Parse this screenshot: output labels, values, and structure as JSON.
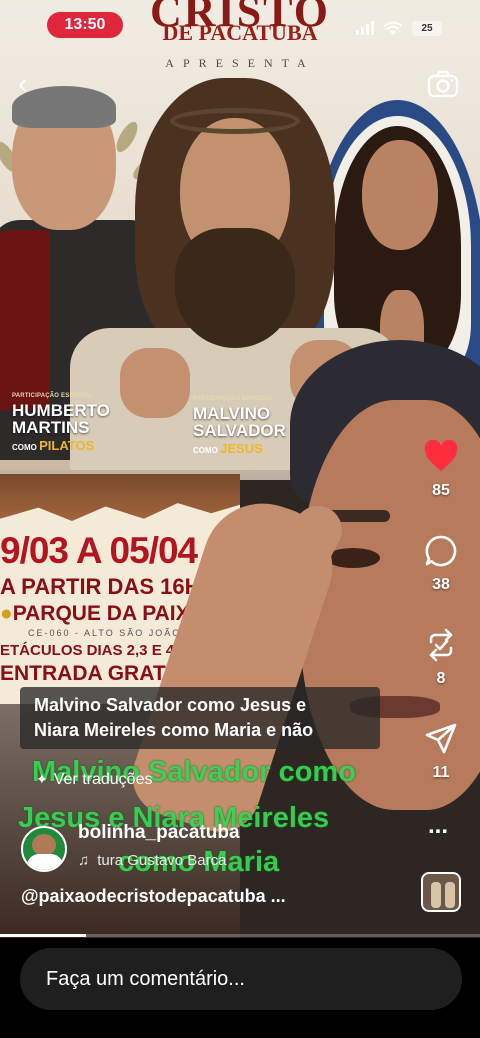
{
  "status_bar": {
    "time": "13:50",
    "battery": "25"
  },
  "poster": {
    "title_partial": "CRISTO",
    "subtitle": "DE PACATUBA",
    "presents": "APRESENTA",
    "credits": [
      {
        "small": "PARTICIPAÇÃO ESPECIAL",
        "line1": "HUMBERTO",
        "line2": "MARTINS",
        "como": "COMO",
        "role": "PILATOS"
      },
      {
        "small": "PARTICIPAÇÃO ESPECIAL",
        "line1": "MALVINO",
        "line2": "SALVADOR",
        "como": "COMO",
        "role": "JESUS"
      }
    ]
  },
  "event_poster": {
    "dates": "9/03 A 05/04",
    "time": "A PARTIR DAS 16H",
    "place": "PARQUE DA PAIXÃO",
    "location": "CE-060 - ALTO SÃO JOÃO",
    "shows": "ETÁCULOS DIAS 2,3 E 4 DE",
    "entry": "ENTRADA GRATUI"
  },
  "actions": {
    "likes": "85",
    "comments": "38",
    "reposts": "8",
    "shares": "11"
  },
  "caption": {
    "line1": "Malvino Salvador como Jesus e",
    "line2": "Niara Meireles como Maria e não"
  },
  "overlay_text": {
    "line1": "Malvino Salvador como",
    "line2": "Jesus e Niara Meireles",
    "line3": "como Maria"
  },
  "translations_label": "Ver traduções",
  "author": {
    "username": "bolinha_pacatuba",
    "music": "tura   Gustavo Barca",
    "more": "..."
  },
  "mention": "@paixaodecristodepacatuba ...",
  "progress_fraction": 0.18,
  "comment_placeholder": "Faça um comentário...",
  "colors": {
    "time_pill": "#e0263a",
    "like_heart": "#ff2d3d",
    "overlay_green": "#39d353"
  },
  "icons": [
    "back-icon",
    "camera-icon",
    "heart-icon",
    "comment-icon",
    "repost-icon",
    "share-icon",
    "music-note-icon",
    "sparkle-icon"
  ]
}
